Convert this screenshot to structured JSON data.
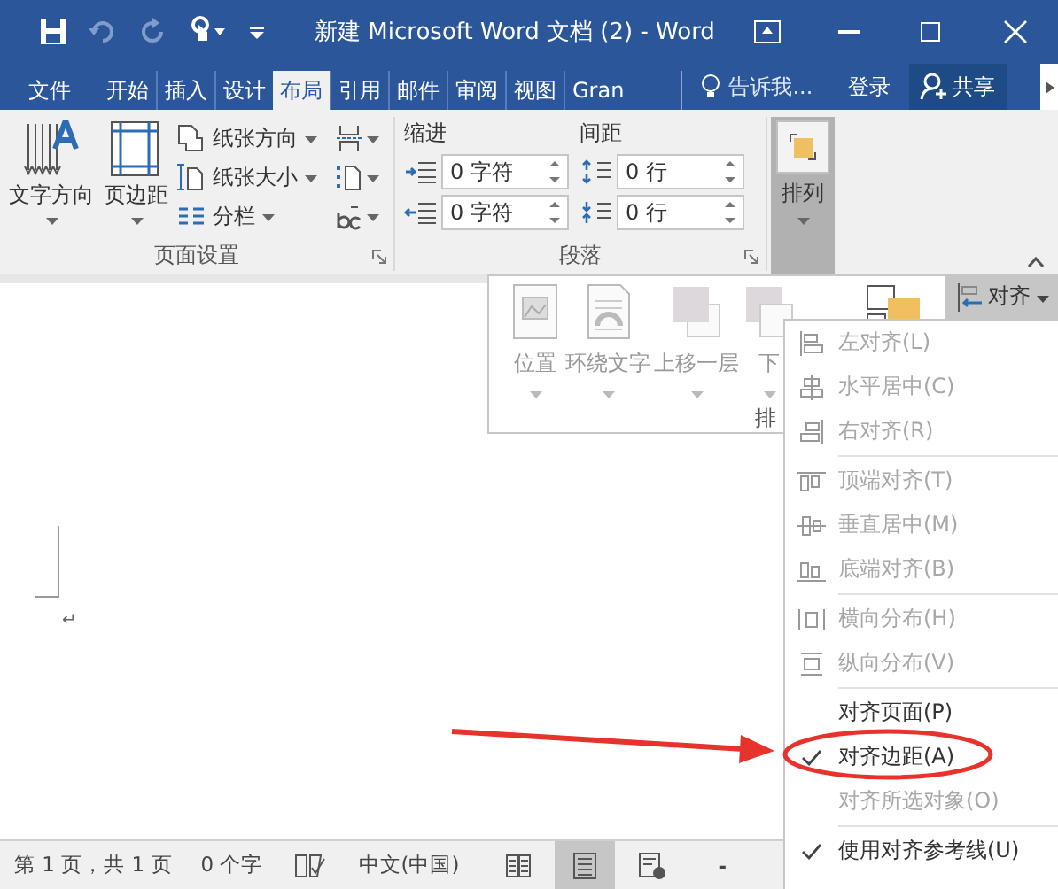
{
  "window": {
    "title": "新建 Microsoft Word 文档 (2) - Word"
  },
  "tabs": [
    {
      "label": "文件",
      "selected": false
    },
    {
      "label": "开始",
      "selected": false
    },
    {
      "label": "插入",
      "selected": false
    },
    {
      "label": "设计",
      "selected": false
    },
    {
      "label": "布局",
      "selected": true
    },
    {
      "label": "引用",
      "selected": false
    },
    {
      "label": "邮件",
      "selected": false
    },
    {
      "label": "审阅",
      "selected": false
    },
    {
      "label": "视图",
      "selected": false
    },
    {
      "label": "Gran",
      "selected": false
    }
  ],
  "tell_me": {
    "placeholder": "告诉我..."
  },
  "sign_in": "登录",
  "share": "共享",
  "page_setup": {
    "title": "页面设置",
    "large_buttons": [
      "文字方向",
      "页边距"
    ],
    "small_buttons": [
      "纸张方向",
      "纸张大小",
      "分栏"
    ]
  },
  "paragraph": {
    "title": "段落",
    "indent_label": "缩进",
    "spacing_label": "间距",
    "indent_left": "0 字符",
    "indent_right": "0 字符",
    "spacing_before": "0 行",
    "spacing_after": "0 行"
  },
  "arrange_button": {
    "label": "排列",
    "expanded": true
  },
  "arrange_panel": {
    "buttons": [
      "位置",
      "环绕文字",
      "上移一层",
      "下"
    ],
    "title": "排",
    "align_button": "对齐"
  },
  "document": {
    "paragraph_mark": "↵"
  },
  "align_menu": {
    "groups": [
      [
        {
          "label": "左对齐(L)",
          "kind": "icon",
          "disabled": true,
          "checked": false
        },
        {
          "label": "水平居中(C)",
          "kind": "icon",
          "disabled": true,
          "checked": false
        },
        {
          "label": "右对齐(R)",
          "kind": "icon",
          "disabled": true,
          "checked": false
        }
      ],
      [
        {
          "label": "顶端对齐(T)",
          "kind": "icon",
          "disabled": true,
          "checked": false
        },
        {
          "label": "垂直居中(M)",
          "kind": "icon",
          "disabled": true,
          "checked": false
        },
        {
          "label": "底端对齐(B)",
          "kind": "icon",
          "disabled": true,
          "checked": false
        }
      ],
      [
        {
          "label": "横向分布(H)",
          "kind": "icon",
          "disabled": true,
          "checked": false
        },
        {
          "label": "纵向分布(V)",
          "kind": "icon",
          "disabled": true,
          "checked": false
        }
      ],
      [
        {
          "label": "对齐页面(P)",
          "kind": "plain",
          "disabled": false,
          "checked": false
        },
        {
          "label": "对齐边距(A)",
          "kind": "plain",
          "disabled": false,
          "checked": true
        },
        {
          "label": "对齐所选对象(O)",
          "kind": "plain",
          "disabled": true,
          "checked": false
        }
      ],
      [
        {
          "label": "使用对齐参考线(U)",
          "kind": "plain",
          "disabled": false,
          "checked": true
        }
      ]
    ]
  },
  "status_bar": {
    "page": "第 1 页，共 1 页",
    "words": "0 个字",
    "language": "中文(中国)",
    "views": [
      {
        "kind": "read",
        "selected": false
      },
      {
        "kind": "print",
        "selected": true
      },
      {
        "kind": "web",
        "selected": false
      }
    ],
    "zoom_out": "-"
  }
}
